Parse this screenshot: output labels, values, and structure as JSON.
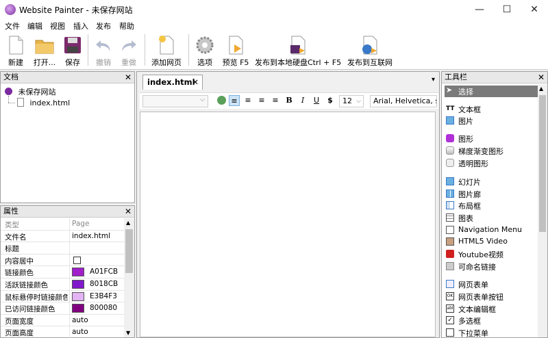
{
  "window": {
    "title": "Website Painter - 未保存网站",
    "minimize": "—",
    "maximize": "☐",
    "close": "✕"
  },
  "menu": [
    "文件",
    "编辑",
    "视图",
    "插入",
    "发布",
    "帮助"
  ],
  "toolbar": {
    "new": "新建",
    "open": "打开...",
    "save": "保存",
    "undo": "撤销",
    "redo": "重做",
    "add_page": "添加网页",
    "options": "选项",
    "preview": "预览 F5",
    "publish_local": "发布到本地硬盘Ctrl + F5",
    "publish_web": "发布到互联网"
  },
  "documents": {
    "title": "文档",
    "close": "✕",
    "site": "未保存网站",
    "page": "index.html"
  },
  "properties": {
    "title": "属性",
    "close": "✕",
    "rows": [
      {
        "key": "类型",
        "value": "Page"
      },
      {
        "key": "文件名",
        "value": "index.html"
      },
      {
        "key": "标题",
        "value": ""
      },
      {
        "key": "内容居中",
        "value": ""
      },
      {
        "key": "链接颜色",
        "value": "A01FCB",
        "color": "#A01FCB"
      },
      {
        "key": "活跃链接颜色",
        "value": "8018CB",
        "color": "#8018CB"
      },
      {
        "key": "鼠标悬停时链接颜色",
        "value": "E3B4F3",
        "color": "#E3B4F3"
      },
      {
        "key": "已访问链接颜色",
        "value": "800080",
        "color": "#800080"
      },
      {
        "key": "页面宽度",
        "value": "auto"
      },
      {
        "key": "页面高度",
        "value": "auto"
      }
    ]
  },
  "editor": {
    "tab_label": "index.html",
    "tab_close": "✕",
    "tab_menu": "▾",
    "font_size": "12",
    "font_family": "Arial, Helvetica, sa",
    "bold": "B",
    "italic": "I",
    "underline": "U",
    "dollar": "$"
  },
  "toolbox": {
    "title": "工具栏",
    "close": "✕",
    "items": [
      {
        "label": "选择",
        "icon": "pointer-icon",
        "selected": true
      },
      {
        "label": "文本框",
        "icon": "text-icon"
      },
      {
        "label": "图片",
        "icon": "image-icon"
      },
      {
        "label": "图形",
        "icon": "shape-icon"
      },
      {
        "label": "梯度渐变图形",
        "icon": "gradient-shape-icon"
      },
      {
        "label": "透明图形",
        "icon": "transparent-shape-icon"
      },
      {
        "label": "幻灯片",
        "icon": "slideshow-icon"
      },
      {
        "label": "图片廊",
        "icon": "gallery-icon"
      },
      {
        "label": "布局框",
        "icon": "layout-icon"
      },
      {
        "label": "图表",
        "icon": "table-icon"
      },
      {
        "label": "Navigation Menu",
        "icon": "nav-menu-icon"
      },
      {
        "label": "HTML5 Video",
        "icon": "video-icon"
      },
      {
        "label": "Youtube视频",
        "icon": "youtube-icon"
      },
      {
        "label": "可命名链接",
        "icon": "anchor-icon"
      },
      {
        "label": "网页表单",
        "icon": "form-icon"
      },
      {
        "label": "网页表单按钮",
        "icon": "form-button-icon"
      },
      {
        "label": "文本编辑框",
        "icon": "textbox-icon"
      },
      {
        "label": "多选框",
        "icon": "checkbox-icon"
      },
      {
        "label": "下拉菜单",
        "icon": "dropdown-icon"
      }
    ]
  }
}
